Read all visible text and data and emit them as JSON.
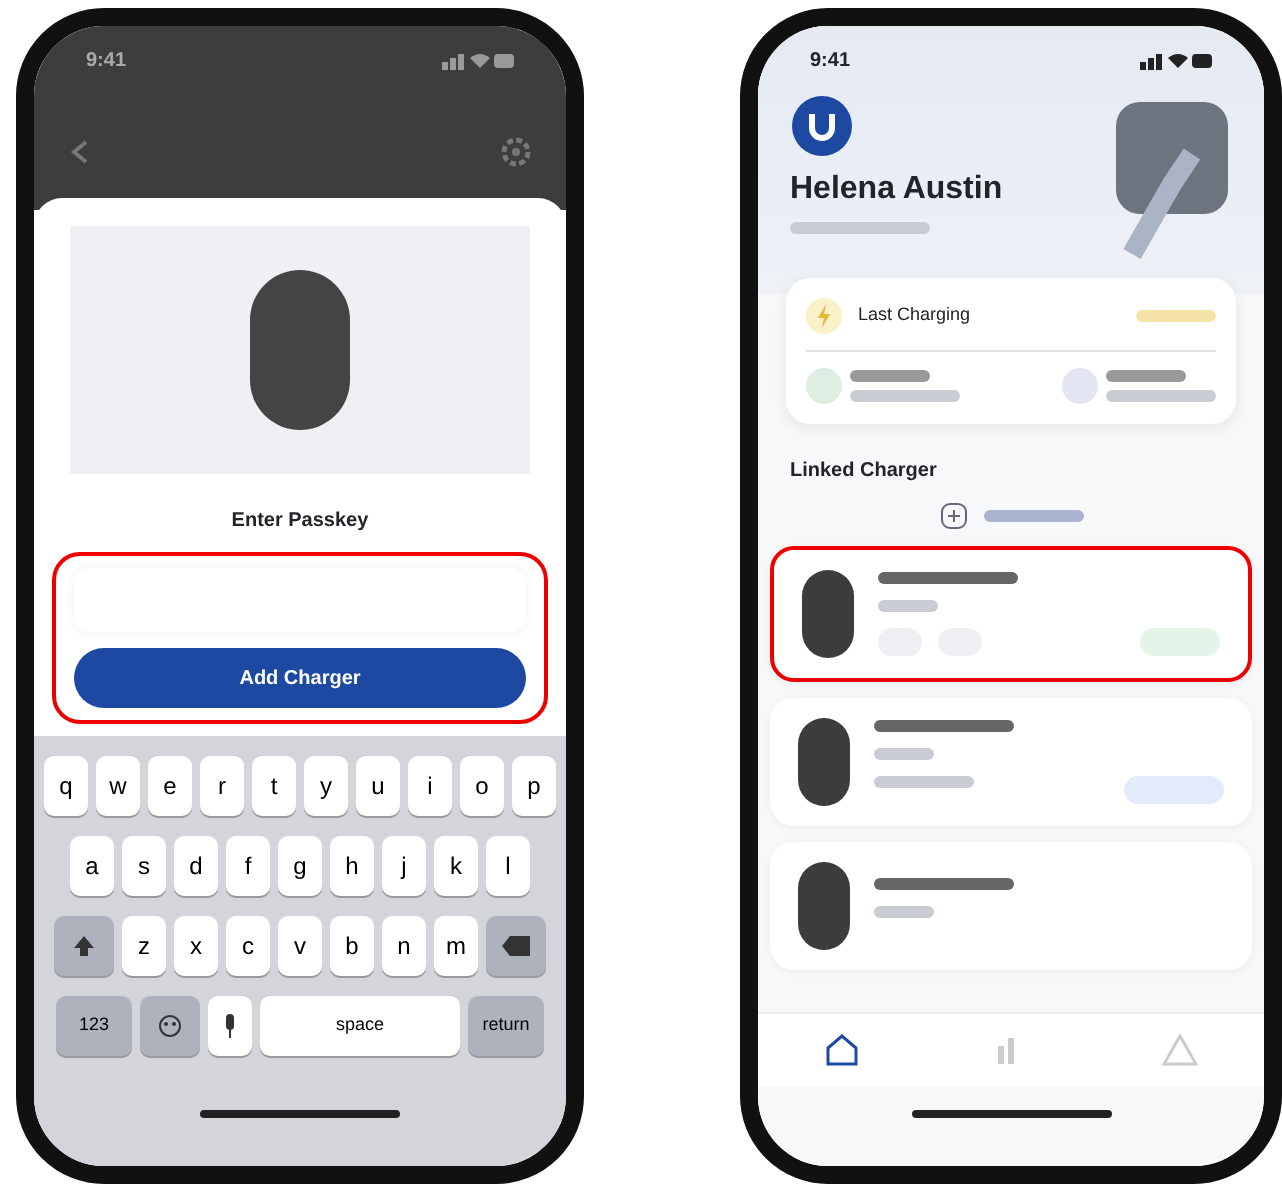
{
  "left_phone": {
    "status_bar": {
      "time": "9:41"
    },
    "passkey_sheet": {
      "title": "Enter Passkey",
      "highlighted": true,
      "button": "Add Charger"
    },
    "keyboard": {
      "rows": [
        {
          "keys": [
            {
              "label": "q",
              "kind": "letter"
            },
            {
              "label": "w",
              "kind": "letter"
            },
            {
              "label": "e",
              "kind": "letter"
            },
            {
              "label": "r",
              "kind": "letter"
            },
            {
              "label": "t",
              "kind": "letter"
            },
            {
              "label": "y",
              "kind": "letter"
            },
            {
              "label": "u",
              "kind": "letter"
            },
            {
              "label": "i",
              "kind": "letter"
            },
            {
              "label": "o",
              "kind": "letter"
            },
            {
              "label": "p",
              "kind": "letter"
            }
          ]
        },
        {
          "keys": [
            {
              "label": "a",
              "kind": "letter"
            },
            {
              "label": "s",
              "kind": "letter"
            },
            {
              "label": "d",
              "kind": "letter"
            },
            {
              "label": "f",
              "kind": "letter"
            },
            {
              "label": "g",
              "kind": "letter"
            },
            {
              "label": "h",
              "kind": "letter"
            },
            {
              "label": "j",
              "kind": "letter"
            },
            {
              "label": "k",
              "kind": "letter"
            },
            {
              "label": "l",
              "kind": "letter"
            }
          ]
        },
        {
          "keys": [
            {
              "kind": "shift"
            },
            {
              "label": "z",
              "kind": "letter"
            },
            {
              "label": "x",
              "kind": "letter"
            },
            {
              "label": "c",
              "kind": "letter"
            },
            {
              "label": "v",
              "kind": "letter"
            },
            {
              "label": "b",
              "kind": "letter"
            },
            {
              "label": "n",
              "kind": "letter"
            },
            {
              "label": "m",
              "kind": "letter"
            },
            {
              "kind": "delete"
            }
          ]
        },
        {
          "keys": [
            {
              "label": "123",
              "kind": "function"
            },
            {
              "kind": "emoji"
            },
            {
              "kind": "mic"
            },
            {
              "label": "space",
              "kind": "space"
            },
            {
              "label": "return",
              "kind": "function"
            }
          ]
        }
      ]
    }
  },
  "right_phone": {
    "status_bar": {
      "time": "9:41"
    },
    "profile": {
      "name": "Helena Austin"
    },
    "summary_card": {
      "title": "Last Charging"
    },
    "section_title": "Linked Charger",
    "chargers": [
      {
        "highlighted": true,
        "kind": "ready"
      },
      {
        "highlighted": false,
        "kind": "charging"
      },
      {
        "highlighted": false,
        "kind": "partial"
      }
    ],
    "tab_bar": {
      "tabs": [
        {
          "selected": true
        },
        {
          "selected": false
        },
        {
          "selected": false
        }
      ]
    }
  }
}
